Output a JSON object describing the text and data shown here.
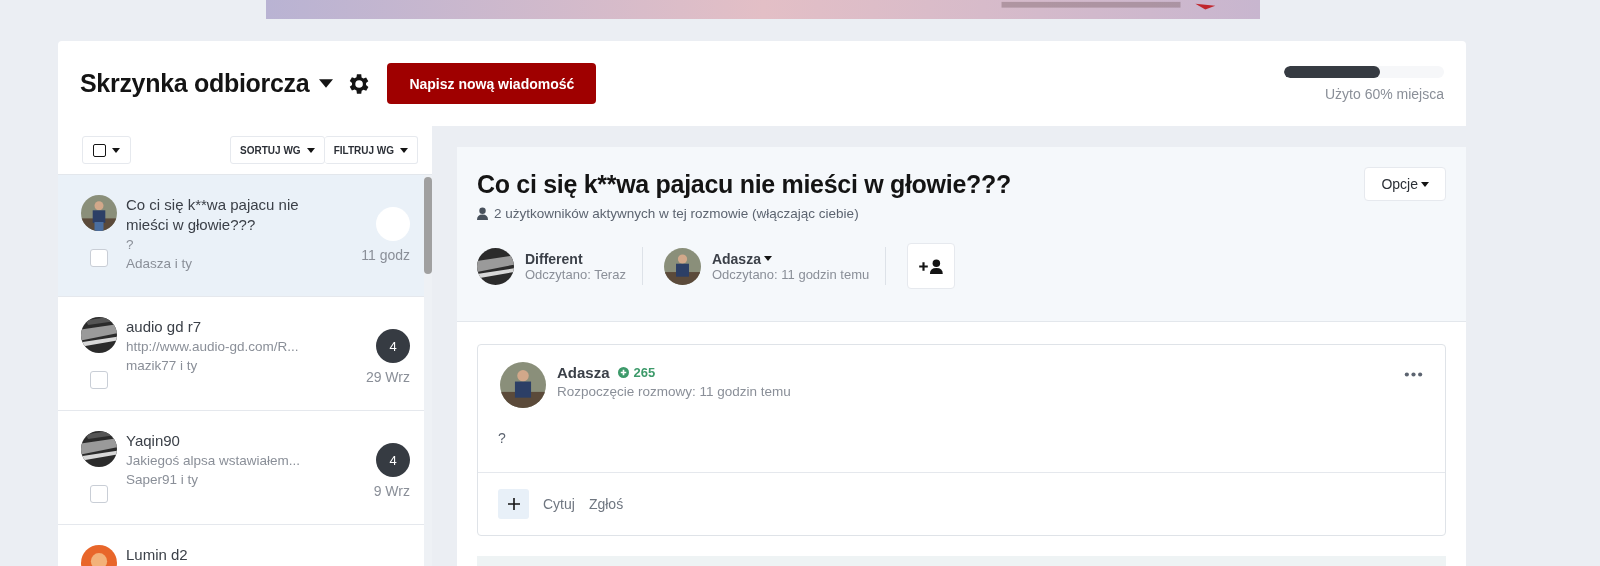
{
  "header": {
    "title": "Skrzynka odbiorcza",
    "compose_button": "Napisz nową wiadomość",
    "storage": {
      "level": 0.6,
      "label": "Użyto 60% miejsca"
    }
  },
  "list_toolbar": {
    "sort": "SORTUJ WG",
    "filter": "FILTRUJ WG"
  },
  "conversations": [
    {
      "title": "Co ci się k**wa pajacu nie mieści w głowie???",
      "snippet": "?",
      "participants": "Adasza i ty",
      "time": "11 godz",
      "selected": true,
      "checked": false
    },
    {
      "title": "audio gd r7",
      "snippet": "http://www.audio-gd.com/R...",
      "participants": "mazik77 i ty",
      "time": "29 Wrz",
      "count": "4",
      "selected": false,
      "checked": false
    },
    {
      "title": "Yaqin90",
      "snippet": "Jakiegoś alpsa wstawiałem...",
      "participants": "Saper91 i ty",
      "time": "9 Wrz",
      "count": "4",
      "selected": false,
      "checked": false
    },
    {
      "title": "Lumin d2",
      "selected": false
    }
  ],
  "conversation": {
    "title": "Co ci się k**wa pajacu nie mieści w głowie???",
    "options_button": "Opcje",
    "active_users": "2 użytkowników aktywnych w tej rozmowie (włączając ciebie)",
    "participants": [
      {
        "name": "Different",
        "read": "Odczytano: Teraz",
        "has_menu": false
      },
      {
        "name": "Adasza",
        "read": "Odczytano: 11 godzin temu",
        "has_menu": true
      }
    ],
    "message": {
      "author": "Adasza",
      "reputation": "265",
      "meta": "Rozpoczęcie rozmowy: 11 godzin temu",
      "body": "?",
      "actions": [
        "Cytuj",
        "Zgłoś"
      ]
    }
  }
}
